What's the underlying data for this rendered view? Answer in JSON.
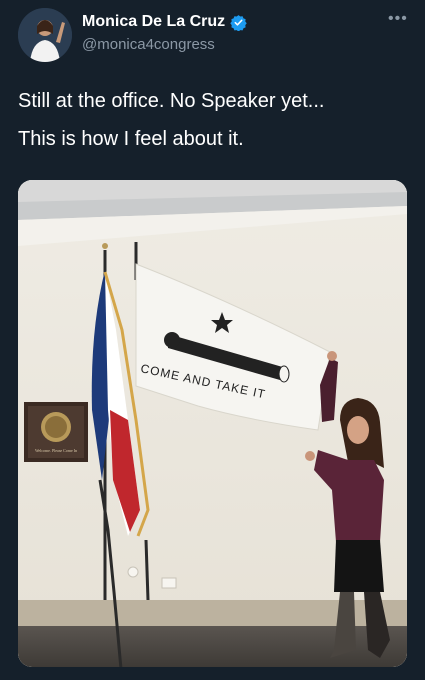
{
  "tweet": {
    "author": {
      "display_name": "Monica De La Cruz",
      "handle": "@monica4congress",
      "verified": true
    },
    "text_lines": [
      "Still at the office. No Speaker yet...",
      "This is how I feel about it."
    ],
    "more_icon": "more-horizontal-icon"
  },
  "photo": {
    "flag_text": "COME AND TAKE IT",
    "plaque_caption": "Welcome. Please Come In"
  },
  "colors": {
    "background": "#15202b",
    "secondary_text": "#8b98a5",
    "verified_blue": "#1d9bf0"
  }
}
